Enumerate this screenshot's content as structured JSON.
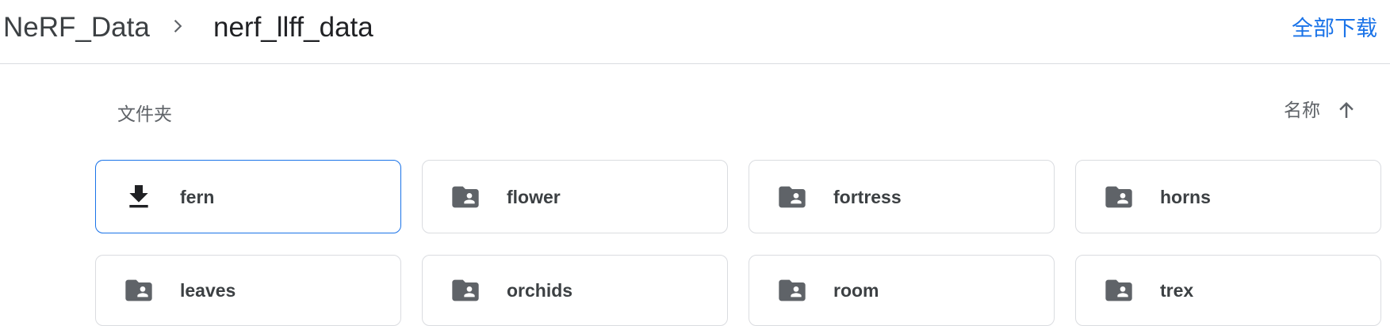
{
  "breadcrumb": {
    "root": "NeRF_Data",
    "separator_icon": "chevron-right-icon",
    "current": "nerf_llff_data"
  },
  "header": {
    "download_all_label": "全部下载"
  },
  "section": {
    "label": "文件夹"
  },
  "sort": {
    "label": "名称",
    "direction_icon": "arrow-up-icon"
  },
  "folders": [
    {
      "name": "fern",
      "icon": "download-icon",
      "selected": true
    },
    {
      "name": "flower",
      "icon": "shared-folder-icon"
    },
    {
      "name": "fortress",
      "icon": "shared-folder-icon"
    },
    {
      "name": "horns",
      "icon": "shared-folder-icon"
    },
    {
      "name": "leaves",
      "icon": "shared-folder-icon"
    },
    {
      "name": "orchids",
      "icon": "shared-folder-icon"
    },
    {
      "name": "room",
      "icon": "shared-folder-icon"
    },
    {
      "name": "trex",
      "icon": "shared-folder-icon"
    }
  ],
  "colors": {
    "accent": "#1a73e8",
    "icon": "#5f6368",
    "border": "#dadce0"
  }
}
